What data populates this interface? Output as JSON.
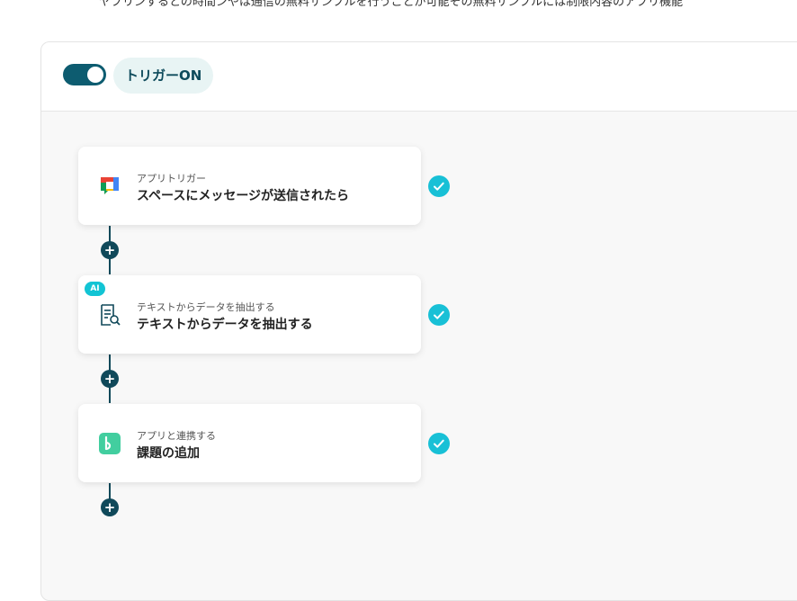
{
  "intro_text": "ヤプリンするとの時間ンやは通信の無料サンプルを行うことが可能その無料サンプルには制限内容のアプリ機能",
  "trigger": {
    "toggle_state": "on",
    "label": "トリガーON"
  },
  "colors": {
    "toggle_bg": "#0d5c70",
    "check_bg": "#18c0d6",
    "connector": "#10495a",
    "ai_badge": "#12c4d4"
  },
  "steps": [
    {
      "icon": "google-chat-icon",
      "subtitle": "アプリトリガー",
      "title": "スペースにメッセージが送信されたら",
      "status": "completed"
    },
    {
      "icon": "document-search-icon",
      "badge": "AI",
      "subtitle": "テキストからデータを抽出する",
      "title": "テキストからデータを抽出する",
      "status": "completed"
    },
    {
      "icon": "backlog-icon",
      "subtitle": "アプリと連携する",
      "title": "課題の追加",
      "status": "completed"
    }
  ],
  "add_step_symbol": "+"
}
